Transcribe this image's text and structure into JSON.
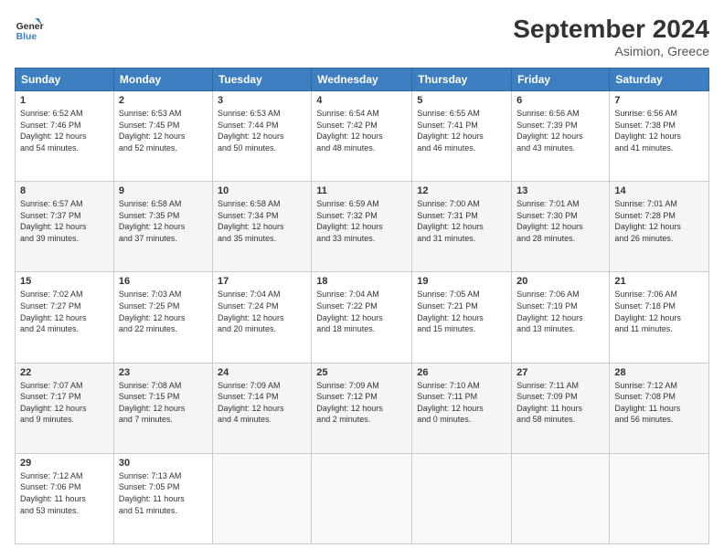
{
  "header": {
    "logo_line1": "General",
    "logo_line2": "Blue",
    "month_title": "September 2024",
    "location": "Asimion, Greece"
  },
  "weekdays": [
    "Sunday",
    "Monday",
    "Tuesday",
    "Wednesday",
    "Thursday",
    "Friday",
    "Saturday"
  ],
  "weeks": [
    [
      {
        "day": "1",
        "info": "Sunrise: 6:52 AM\nSunset: 7:46 PM\nDaylight: 12 hours\nand 54 minutes."
      },
      {
        "day": "2",
        "info": "Sunrise: 6:53 AM\nSunset: 7:45 PM\nDaylight: 12 hours\nand 52 minutes."
      },
      {
        "day": "3",
        "info": "Sunrise: 6:53 AM\nSunset: 7:44 PM\nDaylight: 12 hours\nand 50 minutes."
      },
      {
        "day": "4",
        "info": "Sunrise: 6:54 AM\nSunset: 7:42 PM\nDaylight: 12 hours\nand 48 minutes."
      },
      {
        "day": "5",
        "info": "Sunrise: 6:55 AM\nSunset: 7:41 PM\nDaylight: 12 hours\nand 46 minutes."
      },
      {
        "day": "6",
        "info": "Sunrise: 6:56 AM\nSunset: 7:39 PM\nDaylight: 12 hours\nand 43 minutes."
      },
      {
        "day": "7",
        "info": "Sunrise: 6:56 AM\nSunset: 7:38 PM\nDaylight: 12 hours\nand 41 minutes."
      }
    ],
    [
      {
        "day": "8",
        "info": "Sunrise: 6:57 AM\nSunset: 7:37 PM\nDaylight: 12 hours\nand 39 minutes."
      },
      {
        "day": "9",
        "info": "Sunrise: 6:58 AM\nSunset: 7:35 PM\nDaylight: 12 hours\nand 37 minutes."
      },
      {
        "day": "10",
        "info": "Sunrise: 6:58 AM\nSunset: 7:34 PM\nDaylight: 12 hours\nand 35 minutes."
      },
      {
        "day": "11",
        "info": "Sunrise: 6:59 AM\nSunset: 7:32 PM\nDaylight: 12 hours\nand 33 minutes."
      },
      {
        "day": "12",
        "info": "Sunrise: 7:00 AM\nSunset: 7:31 PM\nDaylight: 12 hours\nand 31 minutes."
      },
      {
        "day": "13",
        "info": "Sunrise: 7:01 AM\nSunset: 7:30 PM\nDaylight: 12 hours\nand 28 minutes."
      },
      {
        "day": "14",
        "info": "Sunrise: 7:01 AM\nSunset: 7:28 PM\nDaylight: 12 hours\nand 26 minutes."
      }
    ],
    [
      {
        "day": "15",
        "info": "Sunrise: 7:02 AM\nSunset: 7:27 PM\nDaylight: 12 hours\nand 24 minutes."
      },
      {
        "day": "16",
        "info": "Sunrise: 7:03 AM\nSunset: 7:25 PM\nDaylight: 12 hours\nand 22 minutes."
      },
      {
        "day": "17",
        "info": "Sunrise: 7:04 AM\nSunset: 7:24 PM\nDaylight: 12 hours\nand 20 minutes."
      },
      {
        "day": "18",
        "info": "Sunrise: 7:04 AM\nSunset: 7:22 PM\nDaylight: 12 hours\nand 18 minutes."
      },
      {
        "day": "19",
        "info": "Sunrise: 7:05 AM\nSunset: 7:21 PM\nDaylight: 12 hours\nand 15 minutes."
      },
      {
        "day": "20",
        "info": "Sunrise: 7:06 AM\nSunset: 7:19 PM\nDaylight: 12 hours\nand 13 minutes."
      },
      {
        "day": "21",
        "info": "Sunrise: 7:06 AM\nSunset: 7:18 PM\nDaylight: 12 hours\nand 11 minutes."
      }
    ],
    [
      {
        "day": "22",
        "info": "Sunrise: 7:07 AM\nSunset: 7:17 PM\nDaylight: 12 hours\nand 9 minutes."
      },
      {
        "day": "23",
        "info": "Sunrise: 7:08 AM\nSunset: 7:15 PM\nDaylight: 12 hours\nand 7 minutes."
      },
      {
        "day": "24",
        "info": "Sunrise: 7:09 AM\nSunset: 7:14 PM\nDaylight: 12 hours\nand 4 minutes."
      },
      {
        "day": "25",
        "info": "Sunrise: 7:09 AM\nSunset: 7:12 PM\nDaylight: 12 hours\nand 2 minutes."
      },
      {
        "day": "26",
        "info": "Sunrise: 7:10 AM\nSunset: 7:11 PM\nDaylight: 12 hours\nand 0 minutes."
      },
      {
        "day": "27",
        "info": "Sunrise: 7:11 AM\nSunset: 7:09 PM\nDaylight: 11 hours\nand 58 minutes."
      },
      {
        "day": "28",
        "info": "Sunrise: 7:12 AM\nSunset: 7:08 PM\nDaylight: 11 hours\nand 56 minutes."
      }
    ],
    [
      {
        "day": "29",
        "info": "Sunrise: 7:12 AM\nSunset: 7:06 PM\nDaylight: 11 hours\nand 53 minutes."
      },
      {
        "day": "30",
        "info": "Sunrise: 7:13 AM\nSunset: 7:05 PM\nDaylight: 11 hours\nand 51 minutes."
      },
      null,
      null,
      null,
      null,
      null
    ]
  ]
}
